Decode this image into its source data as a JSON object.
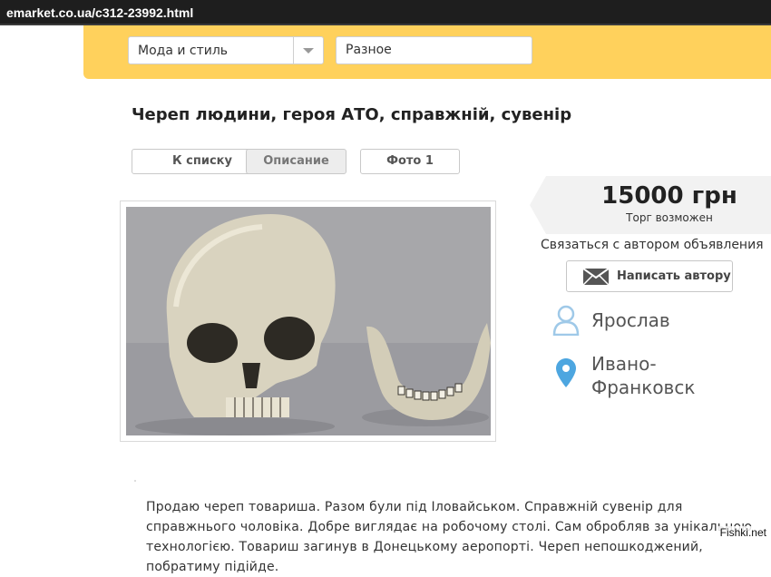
{
  "browser": {
    "url": "emarket.co.ua/c312-23992.html"
  },
  "filters": {
    "category": "Мода и стиль",
    "subcategory": "Разное"
  },
  "listing": {
    "title": "Череп людини, героя АТО, справжній, сувенір",
    "tabs": [
      "К списку",
      "Описание",
      "Фото 1"
    ],
    "active_tab": "Описание",
    "price": "15000 грн",
    "price_note": "Торг возможен",
    "contact_heading": "Связаться с автором объявления",
    "write_button": "Написать автору",
    "author": "Ярослав",
    "city": "Ивано-Франковск",
    "description": "Продаю череп товариша. Разом були під Іловайськом. Справжній сувенір для справжнього чоловіка. Добре виглядає на робочому столі. Сам обробляв за унікальною технологією. Товариш загинув в Донецькому аеропорті. Череп непошкоджений, побратиму підійде."
  },
  "icons": {
    "dropdown": "chevron-down-icon",
    "mail": "envelope-icon",
    "user": "user-icon",
    "location": "map-pin-icon"
  },
  "colors": {
    "header_band": "#ffd15c",
    "pin": "#4da6e0",
    "user_icon": "#9fc9e8"
  },
  "watermark": "Fishki.net"
}
